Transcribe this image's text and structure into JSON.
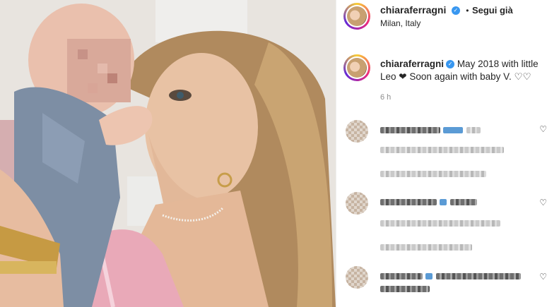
{
  "post": {
    "username": "chiaraferragni",
    "separator": "•",
    "follow_status": "Segui già",
    "location": "Milan, Italy"
  },
  "caption": {
    "username": "chiaraferragni",
    "text": "May 2018 with little Leo ❤ Soon again with baby V. ♡♡",
    "time": "6 h"
  },
  "photo": {
    "description_icon": "photo"
  },
  "colors": {
    "verified": "#3897f0",
    "ring": "#ee2a7b"
  }
}
